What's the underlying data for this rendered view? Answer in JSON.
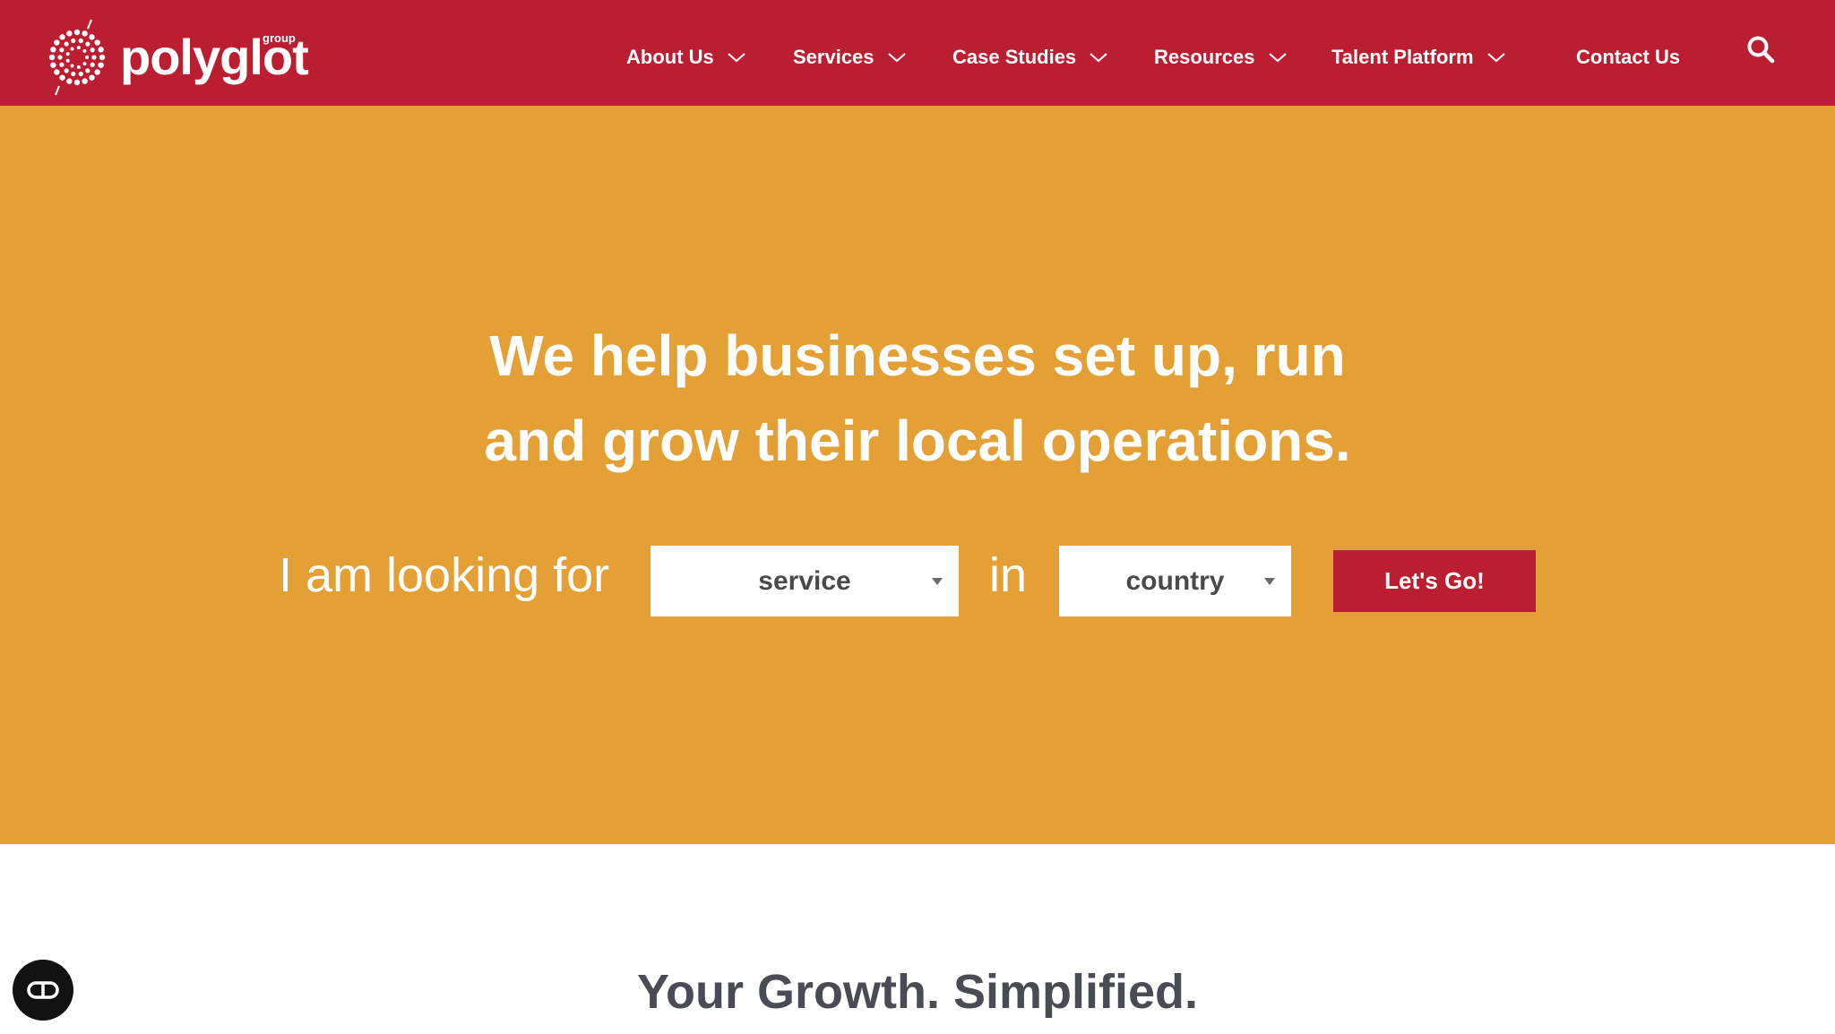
{
  "colors": {
    "header_bg": "#bc1e31",
    "hero_bg": "#e49f35",
    "button_bg": "#bc1e31",
    "subtitle": "#4a4c55"
  },
  "header": {
    "logo_text": "polyglot",
    "logo_superscript": "group",
    "nav": [
      {
        "label": "About Us",
        "has_dropdown": true
      },
      {
        "label": "Services",
        "has_dropdown": true
      },
      {
        "label": "Case Studies",
        "has_dropdown": true
      },
      {
        "label": "Resources",
        "has_dropdown": true
      },
      {
        "label": "Talent Platform",
        "has_dropdown": true
      },
      {
        "label": "Contact Us",
        "has_dropdown": false
      }
    ],
    "search_icon": "search-icon"
  },
  "hero": {
    "title_line1": "We help businesses set up, run",
    "title_line2": "and grow their local operations.",
    "looking_for": "I am looking for",
    "service_select": "service",
    "in_text": "in",
    "country_select": "country",
    "cta": "Let's Go!"
  },
  "section": {
    "subtitle": "Your Growth. Simplified."
  },
  "widgets": {
    "chat_icon": "accessibility-icon"
  }
}
